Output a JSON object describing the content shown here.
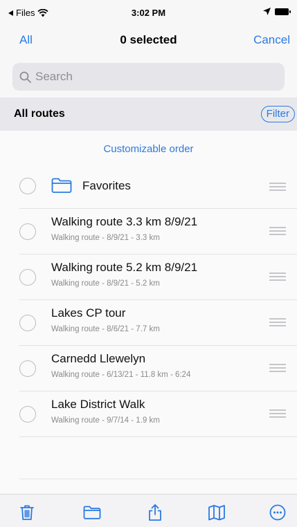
{
  "status_bar": {
    "back_app": "Files",
    "time": "3:02 PM"
  },
  "nav": {
    "left": "All",
    "title": "0 selected",
    "right": "Cancel"
  },
  "search": {
    "placeholder": "Search"
  },
  "section": {
    "title": "All routes",
    "filter": "Filter"
  },
  "order_link": "Customizable order",
  "folder": {
    "title": "Favorites"
  },
  "routes": [
    {
      "title": "Walking route 3.3 km 8/9/21",
      "subtitle": "Walking route - 8/9/21 - 3.3 km"
    },
    {
      "title": "Walking route 5.2 km 8/9/21",
      "subtitle": "Walking route - 8/9/21 - 5.2 km"
    },
    {
      "title": "Lakes CP tour",
      "subtitle": "Walking route - 8/6/21 - 7.7 km"
    },
    {
      "title": "Carnedd Llewelyn",
      "subtitle": "Walking route - 6/13/21 - 11.8 km - 6:24"
    },
    {
      "title": "Lake District Walk",
      "subtitle": "Walking route - 9/7/14 - 1.9 km"
    }
  ],
  "toolbar": {
    "items": [
      "trash-icon",
      "folder-icon",
      "share-icon",
      "map-icon",
      "more-icon"
    ]
  },
  "colors": {
    "accent": "#2a7ae2",
    "background": "#f7f7f7",
    "section_background": "#e8e8ec"
  }
}
